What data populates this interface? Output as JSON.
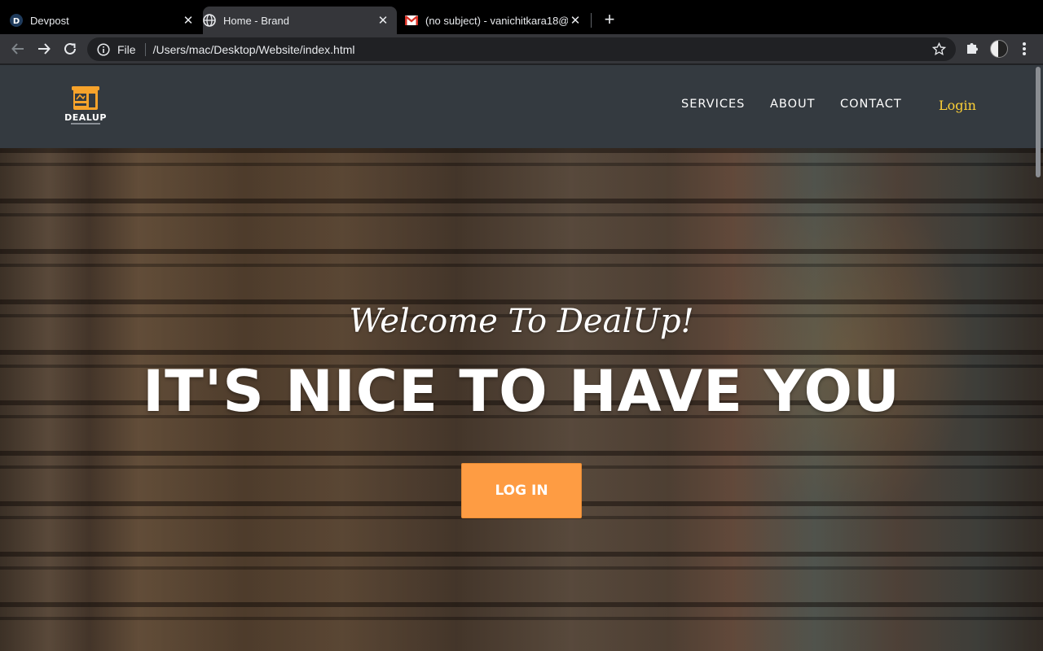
{
  "browser": {
    "tabs": [
      {
        "title": "Devpost",
        "favicon": "devpost-icon",
        "active": false
      },
      {
        "title": "Home - Brand",
        "favicon": "globe-icon",
        "active": true
      },
      {
        "title": "(no subject) - vanichitkara18@",
        "favicon": "gmail-icon",
        "active": false
      }
    ],
    "new_tab_label": "+",
    "address": {
      "scheme": "File",
      "url": "/Users/mac/Desktop/Website/index.html"
    }
  },
  "site": {
    "logo_text": "DEALUP",
    "logo_color": "#f7a32b",
    "nav": {
      "services": "SERVICES",
      "about": "ABOUT",
      "contact": "CONTACT",
      "login": "Login"
    },
    "hero": {
      "welcome": "Welcome To DealUp!",
      "headline": "IT'S NICE TO HAVE YOU",
      "cta": "LOG IN"
    },
    "colors": {
      "nav_bg": "#343a40",
      "login_link": "#fed136",
      "cta_bg": "#fe9c43"
    }
  }
}
